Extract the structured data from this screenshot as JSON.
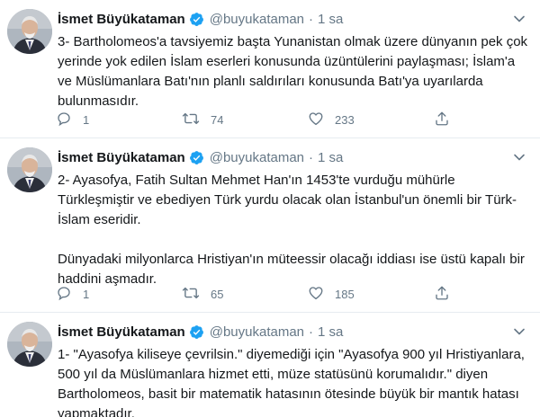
{
  "tweets": [
    {
      "author": "İsmet Büyükataman",
      "handle": "@buyukataman",
      "separator": "·",
      "time": "1 sa",
      "paragraphs": [
        "3- Bartholomeos'a tavsiyemiz başta Yunanistan olmak üzere dünyanın pek çok yerinde yok edilen İslam eserleri konusunda üzüntülerini paylaşması; İslam'a ve Müslümanlara Batı'nın planlı saldırıları konusunda Batı'ya uyarılarda bulunmasıdır."
      ],
      "replies": "1",
      "retweets": "74",
      "likes": "233"
    },
    {
      "author": "İsmet Büyükataman",
      "handle": "@buyukataman",
      "separator": "·",
      "time": "1 sa",
      "paragraphs": [
        "2- Ayasofya, Fatih Sultan Mehmet Han'ın 1453'te vurduğu mühürle Türkleşmiştir ve ebediyen Türk yurdu olacak olan İstanbul'un önemli bir Türk-İslam eseridir.",
        "Dünyadaki milyonlarca Hristiyan'ın müteessir olacağı iddiası ise üstü kapalı bir haddini aşmadır."
      ],
      "replies": "1",
      "retweets": "65",
      "likes": "185"
    },
    {
      "author": "İsmet Büyükataman",
      "handle": "@buyukataman",
      "separator": "·",
      "time": "1 sa",
      "paragraphs": [
        "1- \"Ayasofya kiliseye çevrilsin.\" diyemediği için \"Ayasofya 900 yıl Hristiyanlara, 500 yıl da Müslümanlara hizmet etti, müze statüsünü korumalıdır.\" diyen Bartholomeos, basit bir matematik hatasının ötesinde büyük bir mantık hatası yapmaktadır."
      ]
    }
  ],
  "icons": {
    "verified": "verified-badge-icon",
    "caret": "chevron-down-icon",
    "reply": "reply-icon",
    "retweet": "retweet-icon",
    "like": "heart-icon",
    "share": "share-icon"
  },
  "colors": {
    "text": "#14171a",
    "secondary": "#657786",
    "verified": "#1da1f2",
    "divider": "#e6ecf0"
  }
}
